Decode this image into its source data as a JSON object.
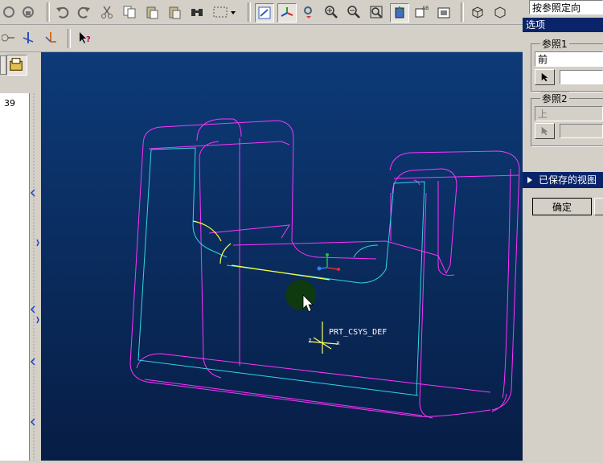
{
  "dialog": {
    "orient_mode_value": "按参照定向",
    "options_label": "选项",
    "ref1": {
      "label": "参照1",
      "value": "前"
    },
    "ref2": {
      "label": "参照2",
      "value": "上"
    },
    "saved_views_label": "已保存的视图",
    "ok_label": "确定"
  },
  "tree": {
    "row_value": "39"
  },
  "viewport": {
    "csys_label": "PRT_CSYS_DEF",
    "csys_axis_z": "z",
    "csys_axis_x": "x",
    "background_top": "#0d3a78",
    "background_bottom": "#071d45",
    "model_outline_color": "#ff33ff",
    "edge_color": "#33d6e6",
    "highlight_color": "#ffff33"
  }
}
